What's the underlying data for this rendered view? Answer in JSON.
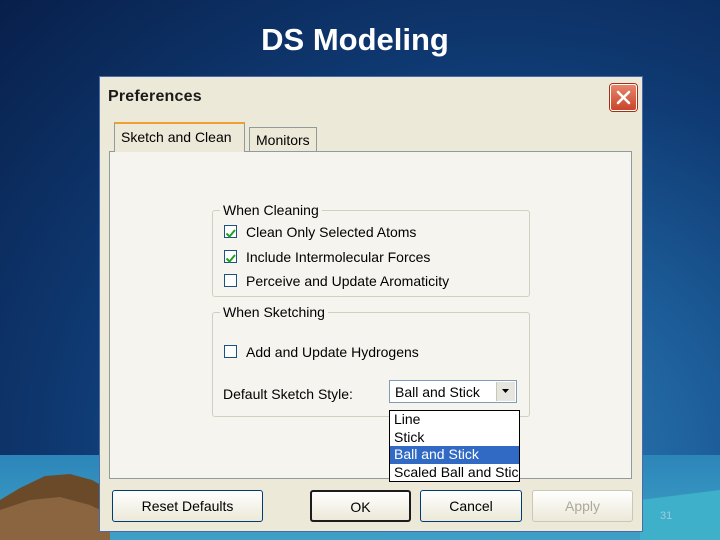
{
  "slide": {
    "title": "DS Modeling",
    "page_number": "31"
  },
  "dialog": {
    "title": "Preferences",
    "tabs": [
      {
        "label": "Sketch and Clean",
        "active": true
      },
      {
        "label": "Monitors",
        "active": false
      }
    ],
    "when_cleaning": {
      "label": "When Cleaning",
      "options": [
        {
          "label": "Clean Only Selected Atoms",
          "checked": true
        },
        {
          "label": "Include Intermolecular Forces",
          "checked": true
        },
        {
          "label": "Perceive and Update Aromaticity",
          "checked": false
        }
      ]
    },
    "when_sketching": {
      "label": "When Sketching",
      "add_hydrogens": {
        "label": "Add and Update Hydrogens",
        "checked": false
      },
      "style_label": "Default Sketch Style:",
      "style_value": "Ball and Stick",
      "style_options": [
        "Line",
        "Stick",
        "Ball and Stick",
        "Scaled Ball and Stic"
      ]
    },
    "buttons": {
      "reset": "Reset Defaults",
      "ok": "OK",
      "cancel": "Cancel",
      "apply": "Apply"
    }
  },
  "colors": {
    "selection": "#316ac5",
    "close_button": "#c9452a"
  }
}
